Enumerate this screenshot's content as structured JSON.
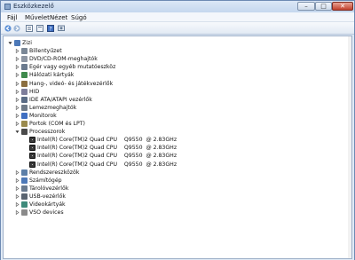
{
  "window": {
    "title": "Eszközkezelő"
  },
  "window_buttons": {
    "minimize": "–",
    "maximize": "□",
    "close": "✕"
  },
  "menu": [
    "Fájl",
    "Művelet",
    "Nézet",
    "Súgó"
  ],
  "toolbar": {
    "buttons": [
      "back-arrow-icon",
      "forward-arrow-icon",
      "tree-view-icon",
      "properties-icon",
      "help-icon",
      "scan-hardware-icon"
    ]
  },
  "tree": {
    "root": "Zizi",
    "nodes": [
      {
        "label": "Billentyűzet",
        "icon": "keyboard-icon"
      },
      {
        "label": "DVD/CD-ROM-meghajtók",
        "icon": "dvd-drive-icon"
      },
      {
        "label": "Egér vagy egyéb mutatóeszköz",
        "icon": "mouse-icon"
      },
      {
        "label": "Hálózati kártyák",
        "icon": "network-card-icon"
      },
      {
        "label": "Hang-, videó- és játékvezérlők",
        "icon": "sound-icon"
      },
      {
        "label": "HID",
        "icon": "hid-icon"
      },
      {
        "label": "IDE ATA/ATAPI vezérlők",
        "icon": "ide-controller-icon"
      },
      {
        "label": "Lemezmeghajtók",
        "icon": "disk-drive-icon"
      },
      {
        "label": "Monitorok",
        "icon": "monitor-icon"
      },
      {
        "label": "Portok (COM és LPT)",
        "icon": "port-icon"
      },
      {
        "label": "Processzorok",
        "icon": "processor-icon",
        "expanded": true,
        "children": [
          "Intel(R) Core(TM)2 Quad CPU    Q9550  @ 2.83GHz",
          "Intel(R) Core(TM)2 Quad CPU    Q9550  @ 2.83GHz",
          "Intel(R) Core(TM)2 Quad CPU    Q9550  @ 2.83GHz",
          "Intel(R) Core(TM)2 Quad CPU    Q9550  @ 2.83GHz"
        ]
      },
      {
        "label": "Rendszereszközök",
        "icon": "system-device-icon"
      },
      {
        "label": "Számítógép",
        "icon": "computer-icon"
      },
      {
        "label": "Tárolóvezérlők",
        "icon": "storage-controller-icon"
      },
      {
        "label": "USB-vezérlők",
        "icon": "usb-icon"
      },
      {
        "label": "Videokártyák",
        "icon": "video-card-icon"
      },
      {
        "label": "VSO devices",
        "icon": "vso-device-icon"
      }
    ]
  },
  "colors": {
    "titlebar": "#c5d7ee",
    "close_button": "#c2402c",
    "pane_border": "#9eb0c8",
    "processor": "#3a3a3a"
  }
}
